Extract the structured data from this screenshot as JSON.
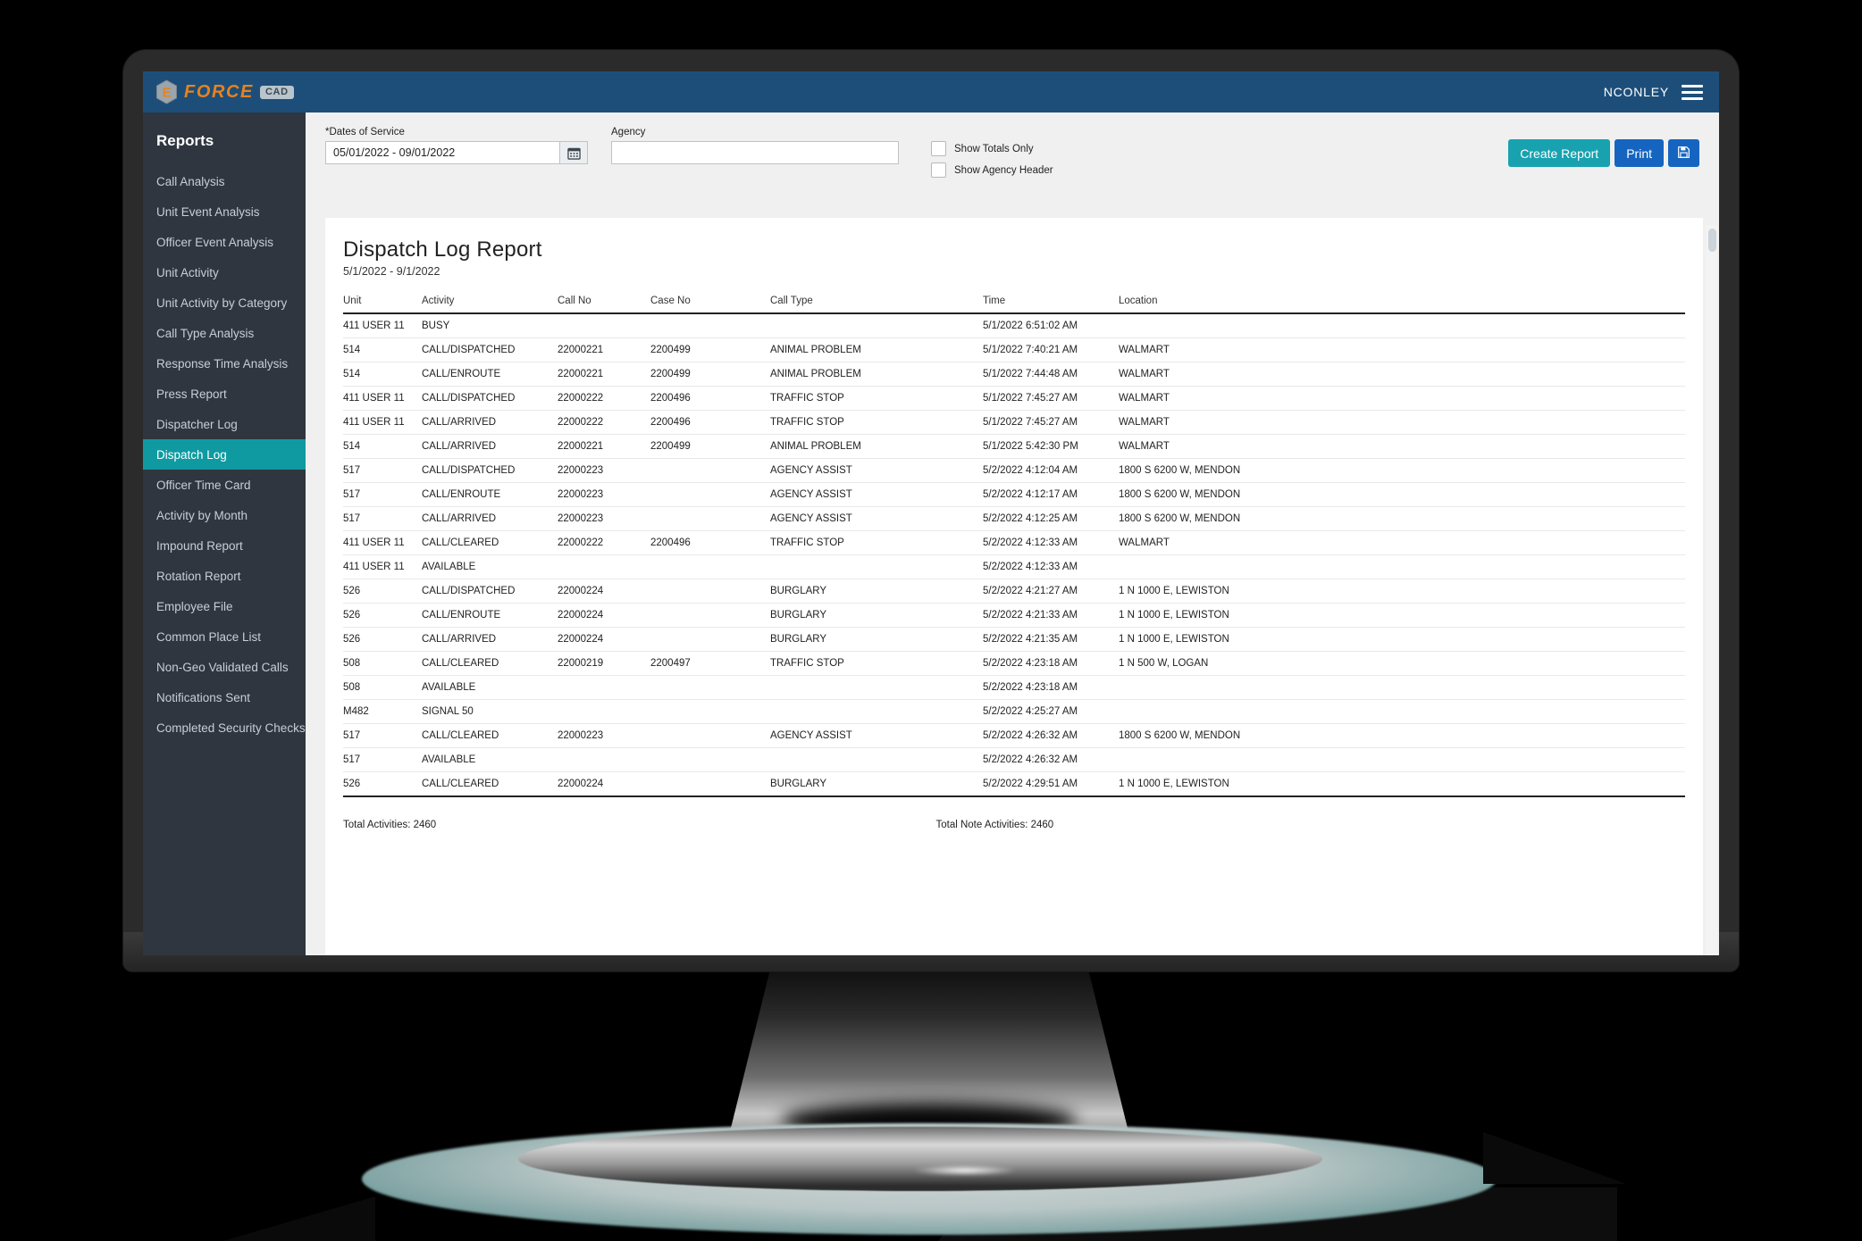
{
  "topbar": {
    "brand_name": "FORCE",
    "brand_sub": "CAD",
    "user": "NCONLEY"
  },
  "sidebar": {
    "title": "Reports",
    "items": [
      {
        "label": "Call Analysis",
        "active": false
      },
      {
        "label": "Unit Event Analysis",
        "active": false
      },
      {
        "label": "Officer Event Analysis",
        "active": false
      },
      {
        "label": "Unit Activity",
        "active": false
      },
      {
        "label": "Unit Activity by Category",
        "active": false
      },
      {
        "label": "Call Type Analysis",
        "active": false
      },
      {
        "label": "Response Time Analysis",
        "active": false
      },
      {
        "label": "Press Report",
        "active": false
      },
      {
        "label": "Dispatcher Log",
        "active": false
      },
      {
        "label": "Dispatch Log",
        "active": true
      },
      {
        "label": "Officer Time Card",
        "active": false
      },
      {
        "label": "Activity by Month",
        "active": false
      },
      {
        "label": "Impound Report",
        "active": false
      },
      {
        "label": "Rotation Report",
        "active": false
      },
      {
        "label": "Employee File",
        "active": false
      },
      {
        "label": "Common Place List",
        "active": false
      },
      {
        "label": "Non-Geo Validated Calls",
        "active": false
      },
      {
        "label": "Notifications Sent",
        "active": false
      },
      {
        "label": "Completed Security Checks",
        "active": false
      }
    ]
  },
  "filters": {
    "dates_label": "*Dates of Service",
    "dates_value": "05/01/2022 - 09/01/2022",
    "dates_placeholder": "",
    "calendar_icon": "calendar-icon",
    "agency_label": "Agency",
    "agency_value": "",
    "agency_placeholder": "",
    "show_totals_only": "Show Totals Only",
    "show_agency_header": "Show Agency Header",
    "create_report": "Create Report",
    "print": "Print",
    "save_icon": "floppy-disk-icon"
  },
  "report": {
    "title": "Dispatch Log Report",
    "date_range": "5/1/2022 - 9/1/2022",
    "columns": [
      "Unit",
      "Activity",
      "Call No",
      "Case No",
      "Call Type",
      "Time",
      "Location"
    ],
    "rows": [
      [
        "411 USER 11",
        "BUSY",
        "",
        "",
        "",
        "5/1/2022 6:51:02 AM",
        ""
      ],
      [
        "514",
        "CALL/DISPATCHED",
        "22000221",
        "2200499",
        "ANIMAL PROBLEM",
        "5/1/2022 7:40:21 AM",
        "WALMART"
      ],
      [
        "514",
        "CALL/ENROUTE",
        "22000221",
        "2200499",
        "ANIMAL PROBLEM",
        "5/1/2022 7:44:48 AM",
        "WALMART"
      ],
      [
        "411 USER 11",
        "CALL/DISPATCHED",
        "22000222",
        "2200496",
        "TRAFFIC STOP",
        "5/1/2022 7:45:27 AM",
        "WALMART"
      ],
      [
        "411 USER 11",
        "CALL/ARRIVED",
        "22000222",
        "2200496",
        "TRAFFIC STOP",
        "5/1/2022 7:45:27 AM",
        "WALMART"
      ],
      [
        "514",
        "CALL/ARRIVED",
        "22000221",
        "2200499",
        "ANIMAL PROBLEM",
        "5/1/2022 5:42:30 PM",
        "WALMART"
      ],
      [
        "517",
        "CALL/DISPATCHED",
        "22000223",
        "",
        "AGENCY ASSIST",
        "5/2/2022 4:12:04 AM",
        "1800 S 6200 W, MENDON"
      ],
      [
        "517",
        "CALL/ENROUTE",
        "22000223",
        "",
        "AGENCY ASSIST",
        "5/2/2022 4:12:17 AM",
        "1800 S 6200 W, MENDON"
      ],
      [
        "517",
        "CALL/ARRIVED",
        "22000223",
        "",
        "AGENCY ASSIST",
        "5/2/2022 4:12:25 AM",
        "1800 S 6200 W, MENDON"
      ],
      [
        "411 USER 11",
        "CALL/CLEARED",
        "22000222",
        "2200496",
        "TRAFFIC STOP",
        "5/2/2022 4:12:33 AM",
        "WALMART"
      ],
      [
        "411 USER 11",
        "AVAILABLE",
        "",
        "",
        "",
        "5/2/2022 4:12:33 AM",
        ""
      ],
      [
        "526",
        "CALL/DISPATCHED",
        "22000224",
        "",
        "BURGLARY",
        "5/2/2022 4:21:27 AM",
        "1 N 1000 E, LEWISTON"
      ],
      [
        "526",
        "CALL/ENROUTE",
        "22000224",
        "",
        "BURGLARY",
        "5/2/2022 4:21:33 AM",
        "1 N 1000 E, LEWISTON"
      ],
      [
        "526",
        "CALL/ARRIVED",
        "22000224",
        "",
        "BURGLARY",
        "5/2/2022 4:21:35 AM",
        "1 N 1000 E, LEWISTON"
      ],
      [
        "508",
        "CALL/CLEARED",
        "22000219",
        "2200497",
        "TRAFFIC STOP",
        "5/2/2022 4:23:18 AM",
        "1 N 500 W, LOGAN"
      ],
      [
        "508",
        "AVAILABLE",
        "",
        "",
        "",
        "5/2/2022 4:23:18 AM",
        ""
      ],
      [
        "M482",
        "SIGNAL 50",
        "",
        "",
        "",
        "5/2/2022 4:25:27 AM",
        ""
      ],
      [
        "517",
        "CALL/CLEARED",
        "22000223",
        "",
        "AGENCY ASSIST",
        "5/2/2022 4:26:32 AM",
        "1800 S 6200 W, MENDON"
      ],
      [
        "517",
        "AVAILABLE",
        "",
        "",
        "",
        "5/2/2022 4:26:32 AM",
        ""
      ],
      [
        "526",
        "CALL/CLEARED",
        "22000224",
        "",
        "BURGLARY",
        "5/2/2022 4:29:51 AM",
        "1 N 1000 E, LEWISTON"
      ]
    ],
    "total_activities": "Total Activities: 2460",
    "total_note_activities": "Total Note Activities: 2460"
  },
  "colors": {
    "topbar": "#1d4e79",
    "sidebar": "#2f3640",
    "active_nav": "#0e9aa0",
    "brand_orange": "#e8821e",
    "primary_btn": "#18a2b0",
    "secondary_btn": "#1565c0"
  }
}
